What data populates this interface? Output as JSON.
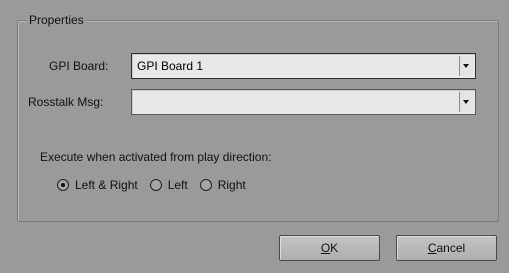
{
  "dialog": {
    "group_title": "Properties",
    "gpi_board": {
      "label": "GPI Board:",
      "value": "GPI Board 1"
    },
    "rosstalk_msg": {
      "label": "Rosstalk Msg:",
      "value": ""
    },
    "execute_label": "Execute when activated from play direction:",
    "direction_options": [
      {
        "label": "Left & Right",
        "selected": true
      },
      {
        "label": "Left",
        "selected": false
      },
      {
        "label": "Right",
        "selected": false
      }
    ]
  },
  "buttons": {
    "ok": {
      "mnemonic": "O",
      "rest": "K"
    },
    "cancel": {
      "mnemonic": "C",
      "rest": "ancel"
    }
  },
  "icons": {
    "combo_arrow": "chevron-down-icon",
    "radio_selected": "radio-selected-icon",
    "radio_unselected": "radio-unselected-icon"
  }
}
